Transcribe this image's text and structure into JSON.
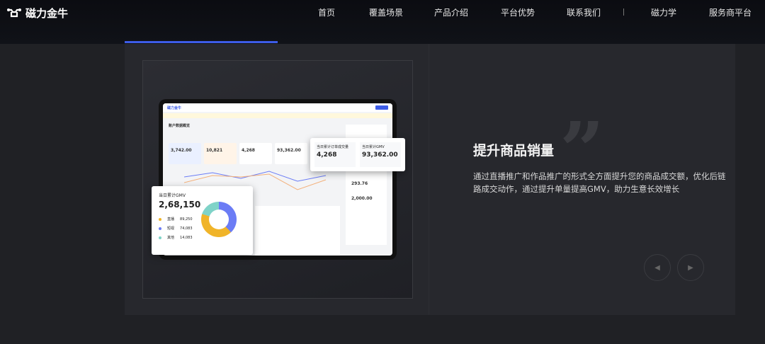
{
  "header": {
    "brand": "磁力金牛",
    "nav": [
      "首页",
      "覆盖场景",
      "产品介绍",
      "平台优势",
      "联系我们",
      "磁力学",
      "服务商平台"
    ]
  },
  "slide": {
    "title": "提升商品销量",
    "description": "通过直播推广和作品推广的形式全方面提升您的商品成交额，优化后链路成交动作，通过提升单量提高GMV，助力生意长效增长",
    "quote_mark": "”"
  },
  "dashboard": {
    "brand": "磁力金牛",
    "section": "账户数据概览",
    "kpis": [
      "3,742.00",
      "10,821",
      "4,268",
      "93,362.00"
    ],
    "float_card": {
      "items": [
        {
          "label": "当日累计订单成交量",
          "value": "4,268"
        },
        {
          "label": "当日累计GMV",
          "value": "93,362.00"
        }
      ]
    },
    "gmv_card": {
      "label": "当日累计GMV",
      "value": "2,68,150",
      "legend": [
        {
          "name": "直播",
          "value": "89,250",
          "color": "#f0b429"
        },
        {
          "name": "短视",
          "value": "74,083",
          "color": "#6b7cf5"
        },
        {
          "name": "其他",
          "value": "14,083",
          "color": "#7fd3c8"
        }
      ]
    },
    "side_values": [
      "293.76",
      "2,000.00"
    ]
  },
  "colors": {
    "accent": "#3d5ce6"
  }
}
